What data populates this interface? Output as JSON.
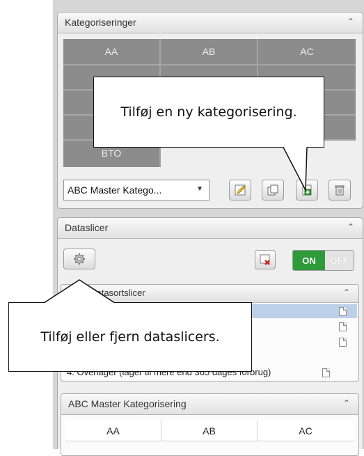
{
  "kategoriseringer": {
    "title": "Kategoriseringer",
    "collapse_glyph": "⌃",
    "grid": [
      [
        "AA",
        "AB",
        "AC"
      ],
      [
        "",
        "",
        ""
      ],
      [
        "",
        "",
        ""
      ],
      [
        "",
        "",
        ""
      ],
      [
        "BTO"
      ]
    ],
    "dropdown_value": "ABC Master Katego...",
    "dropdown_arrow": "▼"
  },
  "dataslicer": {
    "title": "Dataslicer",
    "collapse_glyph": "⌃",
    "toggle_on": "ON",
    "toggle_off": "OFF",
    "subpanel_title": "Lagerdatasortslicer",
    "subpanel_collapse": "⌃",
    "items": [
      "",
      "",
      "",
      "4. Overlager (lager til mere end 365 dages forbrug)"
    ]
  },
  "abc_master": {
    "title": "ABC Master Kategorisering",
    "collapse_glyph": "⌃",
    "columns": [
      "AA",
      "AB",
      "AC"
    ]
  },
  "callouts": {
    "add_categorization": "Tilføj en ny kategorisering.",
    "add_remove_slicers": "Tilføj eller fjern dataslicers."
  },
  "colors": {
    "grid_cell": "#8c8c8c",
    "toggle_on": "#2f9a3a",
    "selected_row": "#bcd0ea"
  }
}
